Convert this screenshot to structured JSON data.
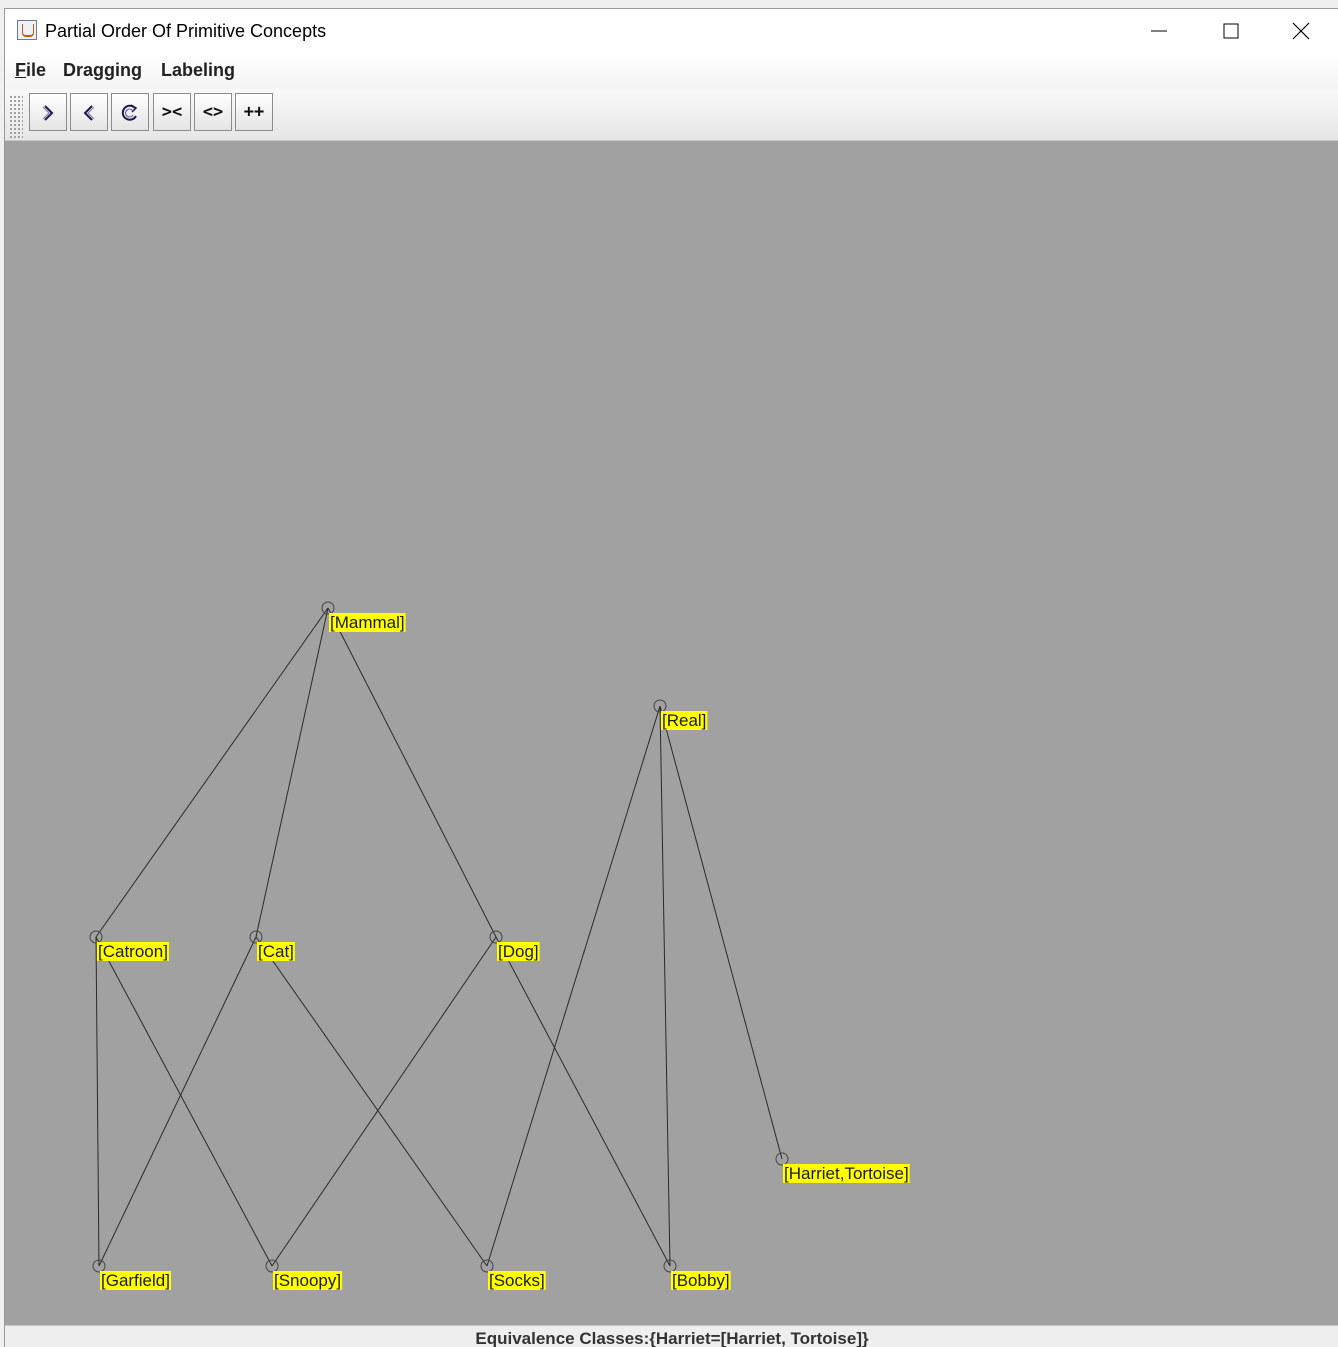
{
  "window": {
    "title": "Partial Order Of Primitive Concepts",
    "icon": "java-icon"
  },
  "title_buttons": [
    "minimize-icon",
    "maximize-icon",
    "close-icon"
  ],
  "menu": {
    "items": [
      {
        "label": "File",
        "mnemonic": "F"
      },
      {
        "label": "Dragging"
      },
      {
        "label": "Labeling"
      }
    ]
  },
  "toolbar": {
    "buttons": [
      {
        "label": "",
        "icon": "chevron-right-icon"
      },
      {
        "label": "",
        "icon": "chevron-left-icon"
      },
      {
        "label": "",
        "icon": "refresh-icon"
      },
      {
        "label": "><"
      },
      {
        "label": "<>"
      },
      {
        "label": "++"
      }
    ]
  },
  "graph": {
    "label_color": "#ffff00",
    "background": "#a1a1a1",
    "nodes": [
      {
        "id": "mammal",
        "label": "[Mammal]"
      },
      {
        "id": "real",
        "label": "[Real]"
      },
      {
        "id": "catroon",
        "label": "[Catroon]"
      },
      {
        "id": "cat",
        "label": "[Cat]"
      },
      {
        "id": "dog",
        "label": "[Dog]"
      },
      {
        "id": "harriet",
        "label": "[Harriet,Tortoise]"
      },
      {
        "id": "garfield",
        "label": "[Garfield]"
      },
      {
        "id": "snoopy",
        "label": "[Snoopy]"
      },
      {
        "id": "socks",
        "label": "[Socks]"
      },
      {
        "id": "bobby",
        "label": "[Bobby]"
      }
    ],
    "edges": [
      [
        "mammal",
        "catroon"
      ],
      [
        "mammal",
        "cat"
      ],
      [
        "mammal",
        "dog"
      ],
      [
        "real",
        "socks"
      ],
      [
        "real",
        "bobby"
      ],
      [
        "real",
        "harriet"
      ],
      [
        "catroon",
        "garfield"
      ],
      [
        "catroon",
        "snoopy"
      ],
      [
        "cat",
        "garfield"
      ],
      [
        "cat",
        "socks"
      ],
      [
        "dog",
        "snoopy"
      ],
      [
        "dog",
        "bobby"
      ]
    ]
  },
  "status": {
    "text": "Equivalence Classes:{Harriet=[Harriet, Tortoise]}"
  }
}
